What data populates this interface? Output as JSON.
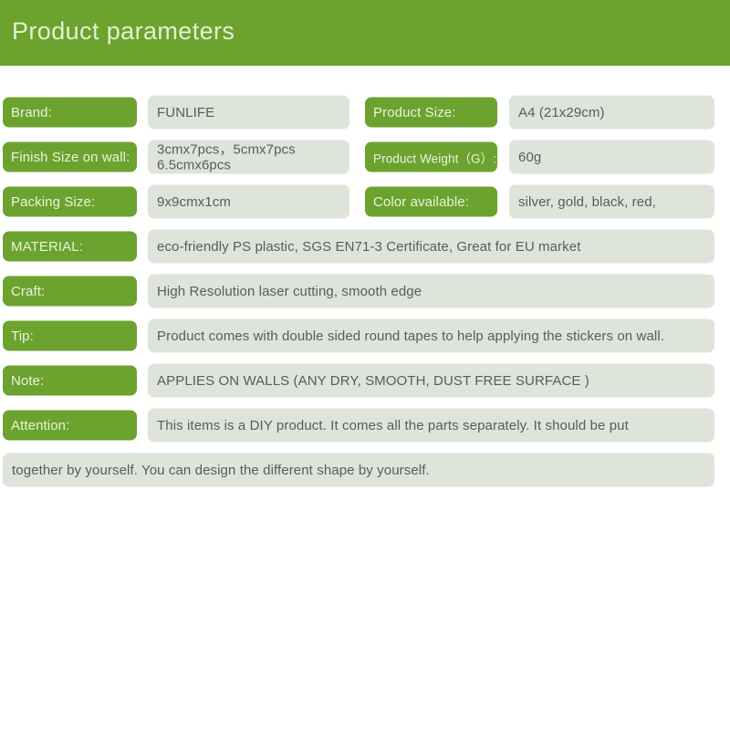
{
  "header": {
    "title": "Product parameters"
  },
  "colors": {
    "brand_green": "#6CA22E",
    "value_box_grey": "#DEE4DA",
    "label_text": "#EAF3DC",
    "value_text": "#575E57",
    "page_background": "#FFFFFF"
  },
  "rows": [
    {
      "left": {
        "label": "Brand:",
        "value": "FUNLIFE"
      },
      "right": {
        "label": "Product Size:",
        "value": "A4 (21x29cm)"
      }
    },
    {
      "left": {
        "label": "Finish Size on wall:",
        "value": "3cmx7pcs，5cmx7pcs\n6.5cmx6pcs"
      },
      "right": {
        "label": "Product Weight（G）:",
        "value": "60g"
      }
    },
    {
      "left": {
        "label": "Packing Size:",
        "value": "9x9cmx1cm"
      },
      "right": {
        "label": "Color available:",
        "value": "silver, gold, black, red,"
      }
    }
  ],
  "full_rows": [
    {
      "label": "MATERIAL:",
      "value": "eco-friendly PS plastic, SGS EN71-3 Certificate, Great for EU market"
    },
    {
      "label": "Craft:",
      "value": "High Resolution laser cutting, smooth edge"
    },
    {
      "label": "Tip:",
      "value": "Product comes with double sided round tapes to help applying the stickers on wall."
    },
    {
      "label": "Note:",
      "value": "APPLIES ON WALLS (ANY DRY, SMOOTH, DUST FREE SURFACE )"
    },
    {
      "label": "Attention:",
      "value": "This items is a DIY product. It comes all the parts separately. It should be put"
    }
  ],
  "continuation_row": {
    "value": "together by yourself. You can design the different shape by yourself."
  }
}
